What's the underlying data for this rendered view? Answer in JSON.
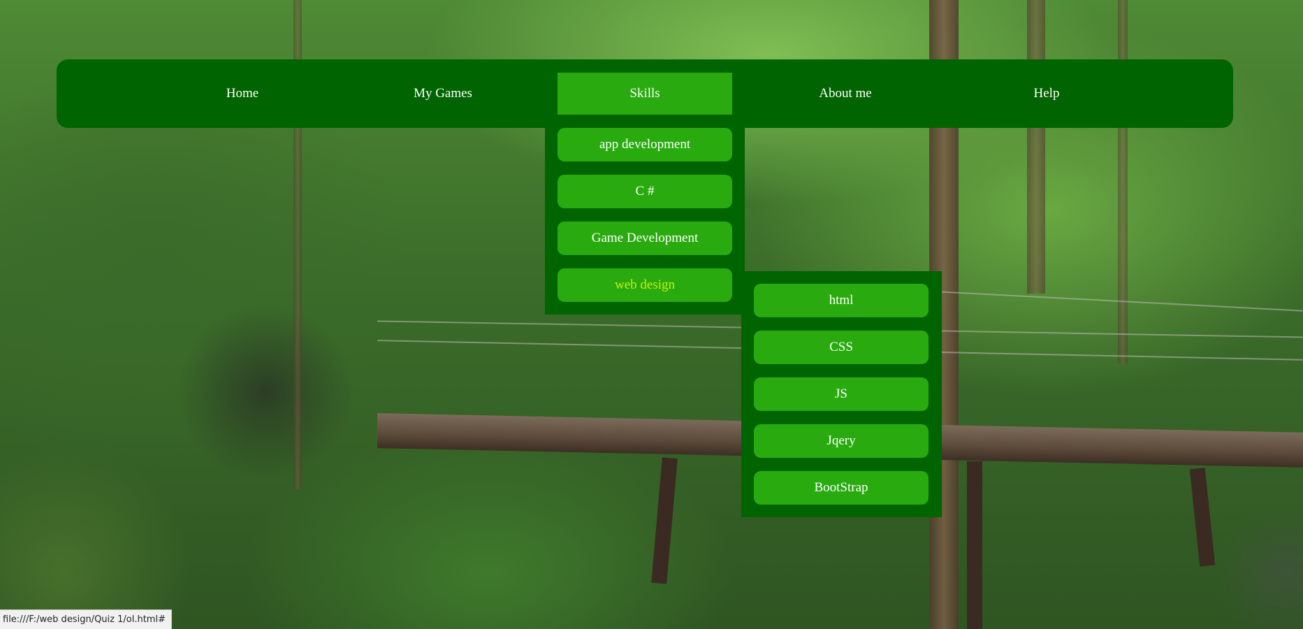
{
  "nav": {
    "items": [
      {
        "label": "Home"
      },
      {
        "label": "My Games"
      },
      {
        "label": "Skills"
      },
      {
        "label": "About me"
      },
      {
        "label": "Help"
      }
    ]
  },
  "skills_menu": {
    "items": [
      {
        "label": "app development"
      },
      {
        "label": "C #"
      },
      {
        "label": "Game Development"
      },
      {
        "label": "web design"
      }
    ]
  },
  "web_design_menu": {
    "items": [
      {
        "label": "html"
      },
      {
        "label": "CSS"
      },
      {
        "label": "JS"
      },
      {
        "label": "Jqery"
      },
      {
        "label": "BootStrap"
      }
    ]
  },
  "status_bar": {
    "url": "file:///F:/web design/Quiz 1/ol.html#"
  },
  "colors": {
    "nav_background": "#006400",
    "button_background": "#29ab10",
    "hover_text": "#c6f000"
  }
}
